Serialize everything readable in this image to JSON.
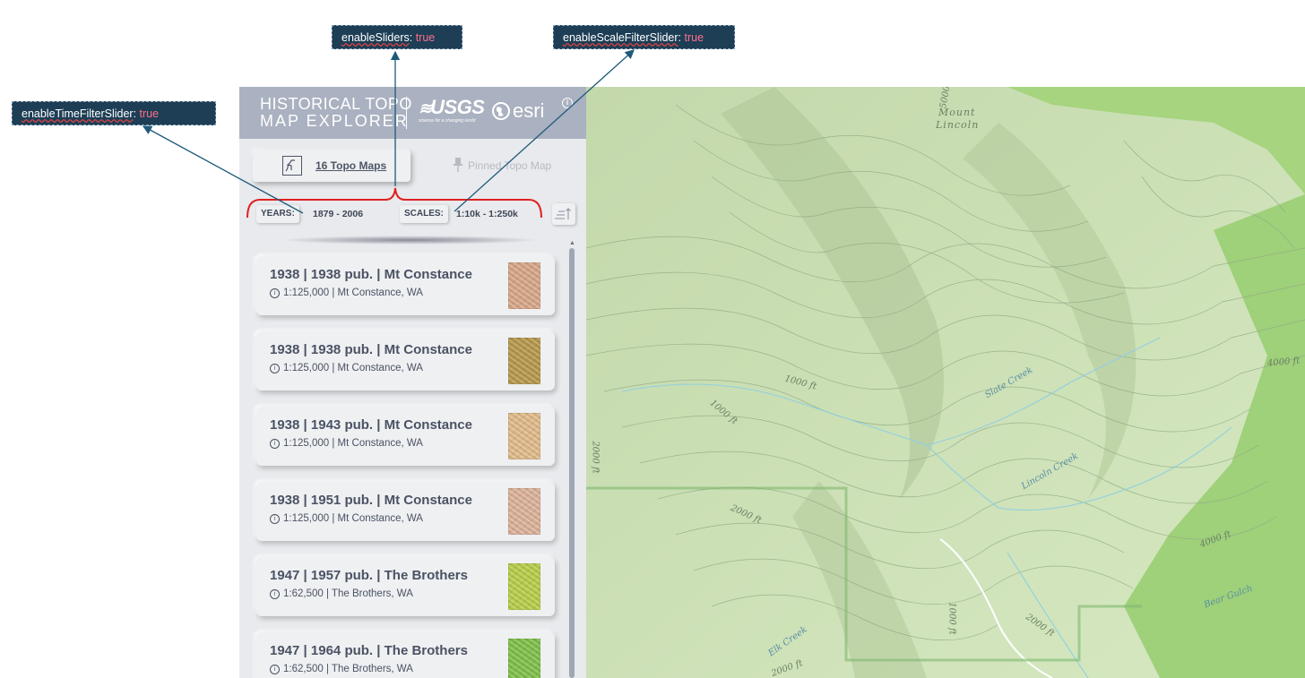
{
  "annotations": [
    {
      "key": "enableTimeFilterSlider",
      "sep": ": ",
      "value": "true"
    },
    {
      "key": "enableSliders",
      "sep": ": ",
      "value": "true"
    },
    {
      "key": "enableScaleFilterSlider",
      "sep": ": ",
      "value": "true"
    }
  ],
  "header": {
    "title_line1": "HISTORICAL TOPO",
    "title_line2": "MAP EXPLORER",
    "usgs_word": "USGS",
    "usgs_tagline": "science for a changing world",
    "esri_word": "esri"
  },
  "tabs": [
    {
      "label": "16 Topo Maps",
      "icon": "map-outline-icon",
      "active": true
    },
    {
      "label": "Pinned Topo Map",
      "icon": "pin-icon",
      "active": false
    }
  ],
  "filters": {
    "years_label": "YEARS:",
    "years_value": "1879 - 2006",
    "scales_label": "SCALES:",
    "scales_value": "1:10k - 1:250k"
  },
  "maps": [
    {
      "title": "1938 | 1938 pub. | Mt Constance",
      "subtitle": "1:125,000 | Mt Constance, WA",
      "thumb_color": "#d9a98a"
    },
    {
      "title": "1938 | 1938 pub. | Mt Constance",
      "subtitle": "1:125,000 | Mt Constance, WA",
      "thumb_color": "#b89a4e"
    },
    {
      "title": "1938 | 1943 pub. | Mt Constance",
      "subtitle": "1:125,000 | Mt Constance, WA",
      "thumb_color": "#e2bd8c"
    },
    {
      "title": "1938 | 1951 pub. | Mt Constance",
      "subtitle": "1:125,000 | Mt Constance, WA",
      "thumb_color": "#ddb49c"
    },
    {
      "title": "1947 | 1957 pub. | The Brothers",
      "subtitle": "1:62,500 | The Brothers, WA",
      "thumb_color": "#b8d04a"
    },
    {
      "title": "1947 | 1964 pub. | The Brothers",
      "subtitle": "1:62,500 | The Brothers, WA",
      "thumb_color": "#7fc24a"
    }
  ],
  "map_labels": [
    {
      "text": "Mount",
      "kind": "peak"
    },
    {
      "text": "Lincoln",
      "kind": "peak"
    },
    {
      "text": "1000 ft",
      "kind": "contour"
    },
    {
      "text": "1000 ft",
      "kind": "contour"
    },
    {
      "text": "Slate Creek",
      "kind": "water"
    },
    {
      "text": "Lincoln Creek",
      "kind": "water"
    },
    {
      "text": "2000 ft",
      "kind": "contour"
    },
    {
      "text": "2000 ft",
      "kind": "contour"
    },
    {
      "text": "4000 ft",
      "kind": "contour"
    },
    {
      "text": "4000 ft",
      "kind": "contour"
    },
    {
      "text": "Bear Gulch",
      "kind": "water"
    },
    {
      "text": "Elk Creek",
      "kind": "water"
    },
    {
      "text": "1000 ft",
      "kind": "contour"
    },
    {
      "text": "2000 ft",
      "kind": "contour"
    },
    {
      "text": "2000 ft",
      "kind": "contour"
    },
    {
      "text": "5000",
      "kind": "contour"
    }
  ],
  "colors": {
    "annotation_bg": "#1d3e55",
    "annotation_value": "#ff6f8a",
    "bracket": "#e02020",
    "arrow": "#1f5a7a",
    "panel_bg": "#e8eaed",
    "header_bg": "#aab1c0",
    "map_base": "#cfe2b8",
    "map_forest": "#9fd07a"
  }
}
